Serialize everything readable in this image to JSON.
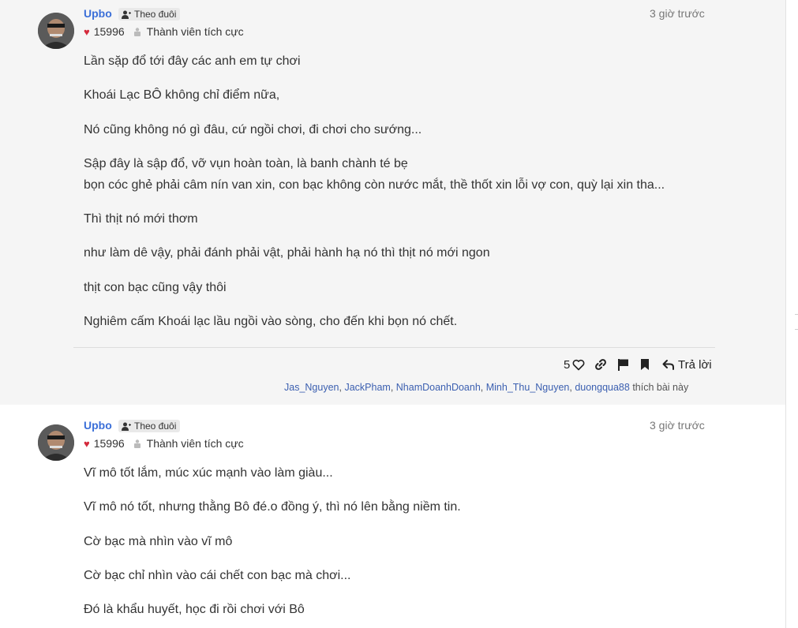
{
  "posts": [
    {
      "author": "Upbo",
      "follow_label": "Theo đuôi",
      "time": "3 giờ trước",
      "score": "15996",
      "rank": "Thành viên tích cực",
      "lines": [
        "Lần sặp đổ tới đây các anh em tự chơi",
        "Khoái Lạc BÔ không chỉ điểm nữa,",
        "Nó cũng không nó gì đâu, cứ ngồi chơi, đi chơi cho sướng...",
        "Sập đây là sập đổ, vỡ vụn hoàn toàn, là banh chành té bẹ",
        "bọn cóc ghẻ phải câm nín van xin, con bạc không còn nước mắt, thề thốt xin lỗi vợ con, quỳ lại xin tha...",
        "Thì thịt nó mới thơm",
        "như làm dê vậy, phải đánh phải vật, phải hành hạ nó thì thịt nó mới ngon",
        "thịt con bạc cũng vậy thôi",
        "Nghiêm cấm Khoái lạc lầu ngồi vào sòng, cho đến khi bọn nó chết."
      ],
      "like_count": "5",
      "reply_label": "Trả lời",
      "likers": [
        "Jas_Nguyen",
        "JackPham",
        "NhamDoanhDoanh",
        "Minh_Thu_Nguyen",
        "duongqua88"
      ],
      "likes_suffix": "thích bài này"
    },
    {
      "author": "Upbo",
      "follow_label": "Theo đuôi",
      "time": "3 giờ trước",
      "score": "15996",
      "rank": "Thành viên tích cực",
      "lines": [
        "Vĩ mô tốt lắm, múc xúc mạnh vào làm giàu...",
        "Vĩ mô nó tốt, nhưng thằng Bô đé.o đồng ý, thì nó lên bằng niềm tin.",
        "Cờ bạc mà nhìn vào vĩ mô",
        "Cờ bạc chỉ nhìn vào cái chết con bạc mà chơi...",
        "Đó là khẩu huyết, học đi rồi chơi với Bô"
      ]
    }
  ],
  "icons": {
    "heart": "heart-icon",
    "follow": "user-plus-icon",
    "rank": "users-icon",
    "like": "heart-outline-icon",
    "link": "link-icon",
    "flag": "flag-icon",
    "bookmark": "bookmark-icon",
    "reply": "reply-icon"
  },
  "colors": {
    "author": "#3b6fd8",
    "heart": "#d42a3c",
    "liker": "#3b5fb0"
  }
}
